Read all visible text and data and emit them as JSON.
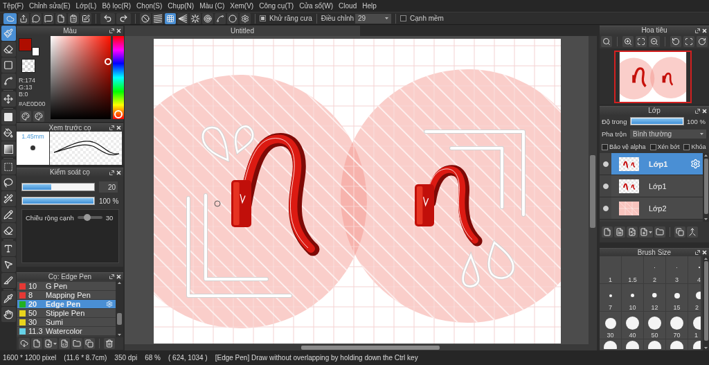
{
  "menu": [
    "Tệp(F)",
    "Chỉnh sửa(E)",
    "Lớp(L)",
    "Bộ lọc(R)",
    "Chọn(S)",
    "Chụp(N)",
    "Màu (C)",
    "Xem(V)",
    "Công cụ(T)",
    "Cửa sổ(W)",
    "Cloud",
    "Help"
  ],
  "toolbar": {
    "cloud_sync": {
      "on": true
    },
    "snap_modes": [
      {
        "selected": false
      },
      {
        "selected": false
      },
      {
        "selected": true
      },
      {
        "selected": false
      },
      {
        "selected": false
      },
      {
        "selected": false
      },
      {
        "selected": false
      },
      {
        "selected": false
      },
      {
        "selected": false
      }
    ],
    "anti_alias": {
      "label": "Khử răng cưa",
      "checked": true
    },
    "correction": {
      "label": "Điều chỉnh",
      "value": "29"
    },
    "soft_edge": {
      "label": "Cạnh mềm",
      "checked": false
    }
  },
  "tools": [
    {
      "selected": true
    },
    {
      "selected": false
    },
    {
      "selected": false
    },
    {
      "selected": false
    },
    {
      "selected": false
    },
    {
      "selected": false
    },
    {
      "selected": false
    },
    {
      "selected": false
    },
    {
      "selected": false
    },
    {
      "selected": false
    },
    {
      "selected": false
    },
    {
      "selected": false
    },
    {
      "selected": false
    },
    {
      "selected": false
    },
    {
      "selected": false
    },
    {
      "selected": false
    },
    {
      "selected": false
    },
    {
      "selected": false
    }
  ],
  "color_panel": {
    "title": "Màu",
    "swatches": [
      {
        "kind": "background",
        "color": "#ffffff"
      },
      {
        "kind": "foreground",
        "color": "#ae0d00"
      }
    ],
    "channels": [
      "R:174",
      "G:13",
      "B:0"
    ],
    "hex": "#AE0D00"
  },
  "brush_preview": {
    "title": "Xem trước cọ",
    "size": "1.45mm"
  },
  "brush_control": {
    "title": "Kiểm soát cọ",
    "size": {
      "level": 0.4,
      "reading": "20"
    },
    "opacity": {
      "level": 1,
      "reading": "100 %"
    },
    "edge_width": {
      "label": "Chiều rộng cạnh",
      "level": 0.4,
      "reading": "30"
    }
  },
  "brushes": {
    "title": "Cọ: Edge Pen",
    "items": [
      {
        "size": "10",
        "name": "G Pen",
        "color": "#e53935",
        "selected": false
      },
      {
        "size": "8",
        "name": "Mapping Pen",
        "color": "#e53935",
        "selected": false
      },
      {
        "size": "20",
        "name": "Edge Pen",
        "color": "#22b022",
        "selected": true
      },
      {
        "size": "50",
        "name": "Stipple Pen",
        "color": "#e8d41c",
        "selected": false
      },
      {
        "size": "30",
        "name": "Sumi",
        "color": "#e8d41c",
        "selected": false
      },
      {
        "size": "11.3",
        "name": "Watercolor",
        "color": "#66d2e8",
        "selected": false
      }
    ]
  },
  "document": {
    "tab": "Untitled"
  },
  "navigator": {
    "title": "Hoa tiêu"
  },
  "layers": {
    "title": "Lớp",
    "opacity": {
      "label": "Độ trong",
      "level": 1,
      "reading": "100 %"
    },
    "blend": {
      "label": "Pha trộn",
      "value": "Bình thường"
    },
    "options": [
      {
        "label": "Bảo vệ alpha",
        "checked": false
      },
      {
        "label": "Xén bớt",
        "checked": false
      },
      {
        "label": "Khóa",
        "checked": false
      }
    ],
    "items": [
      {
        "name": "Lớp1",
        "kind": "ink",
        "visible": true,
        "selected": true
      },
      {
        "name": "Lớp1",
        "kind": "ink",
        "visible": true,
        "selected": false
      },
      {
        "name": "Lớp2",
        "kind": "fill",
        "visible": true,
        "selected": false
      }
    ]
  },
  "brush_size": {
    "title": "Brush Size",
    "cells": [
      {
        "kind": "size",
        "label": "1"
      },
      {
        "kind": "size",
        "label": "1.5"
      },
      {
        "kind": "size",
        "label": "2"
      },
      {
        "kind": "size",
        "label": "3"
      },
      {
        "kind": "size",
        "label": "4"
      },
      {
        "kind": "size",
        "label": "7"
      },
      {
        "kind": "size",
        "label": "10"
      },
      {
        "kind": "size",
        "label": "12"
      },
      {
        "kind": "size",
        "label": "15"
      },
      {
        "kind": "size",
        "label": "2"
      },
      {
        "kind": "size",
        "label": "30"
      },
      {
        "kind": "size",
        "label": "40"
      },
      {
        "kind": "size",
        "label": "50"
      },
      {
        "kind": "size",
        "label": "70"
      },
      {
        "kind": "size",
        "label": "1"
      },
      {
        "kind": "cut"
      },
      {
        "kind": "cut"
      },
      {
        "kind": "cut"
      },
      {
        "kind": "cut"
      },
      {
        "kind": "cut"
      }
    ]
  },
  "status_bar": [
    "1600 * 1200 pixel",
    "(11.6 * 8.7cm)",
    "350 dpi",
    "68 %",
    "( 624, 1034 )",
    "[Edge Pen] Draw without overlapping by holding down the Ctrl key"
  ]
}
